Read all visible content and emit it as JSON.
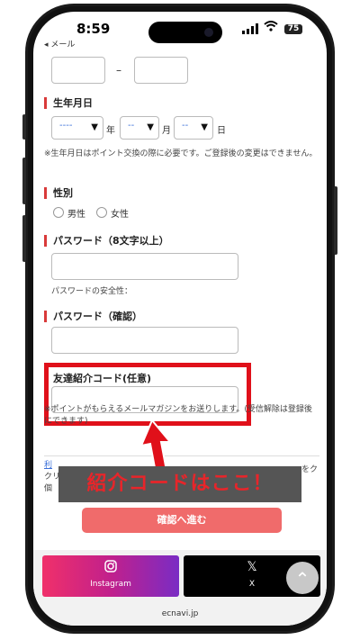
{
  "status": {
    "time": "8:59",
    "back_label": "◂ メール",
    "battery": "75"
  },
  "birthdate": {
    "label": "生年月日",
    "year_placeholder": "----",
    "month_placeholder": "--",
    "day_placeholder": "--",
    "year_unit": "年",
    "month_unit": "月",
    "day_unit": "日",
    "note": "※生年月日はポイント交換の際に必要です。ご登録後の変更はできません。"
  },
  "phone_separator": "–",
  "gender": {
    "label": "性別",
    "male": "男性",
    "female": "女性"
  },
  "password": {
    "label": "パスワード（8文字以上）",
    "strength_label": "パスワードの安全性："
  },
  "password_confirm": {
    "label": "パスワード（確認）"
  },
  "referral": {
    "label": "友達紹介コード(任意)",
    "note": "※ポイントがもらえるメールマガジンをお送りします。(受信解除は登録後にできます)"
  },
  "terms_partial": {
    "line1": "利",
    "line2": "クリ",
    "line3": "個",
    "tail": "をク"
  },
  "annotation_banner": "紹介コードはここ！",
  "confirm_button": "確認へ進む",
  "sns": {
    "instagram": "Instagram",
    "x": "X"
  },
  "footer_domain": "ecnavi.jp",
  "colors": {
    "accent": "#d93a3a",
    "highlight": "#e0101a",
    "cta": "#f06b6b"
  }
}
